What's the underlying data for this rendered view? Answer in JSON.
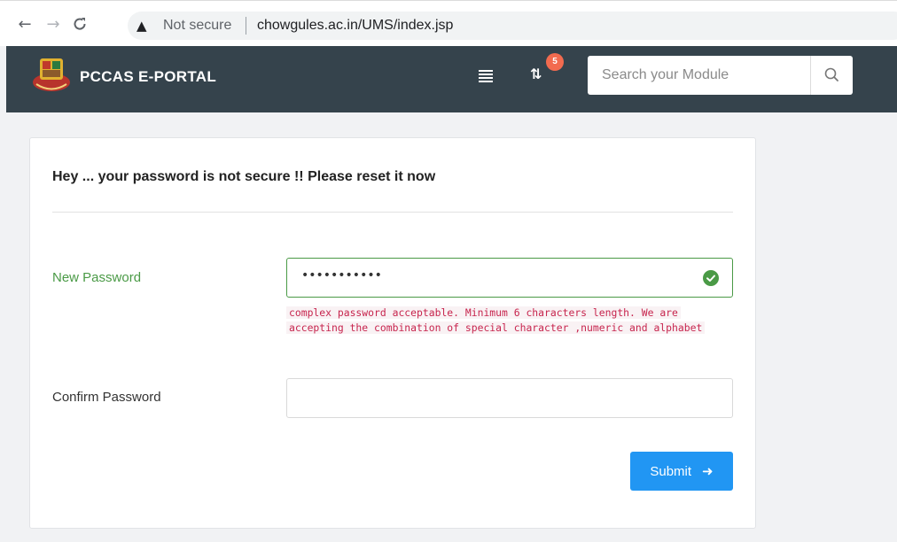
{
  "browser": {
    "back_icon": "←",
    "forward_icon": "→",
    "reload_icon": "C",
    "security_icon": "▲",
    "security_text": "Not secure",
    "url": "chowgules.ac.in/UMS/index.jsp"
  },
  "header": {
    "brand": "PCCAS E-PORTAL",
    "notification_count": "5",
    "sync_icon": "⇅",
    "search_placeholder": "Search your Module",
    "background": "#35434c"
  },
  "form": {
    "title": "Hey ... your password is not secure !! Please reset it now",
    "new_password_label": "New Password",
    "new_password_value": "•••••••••••",
    "hint": "complex password acceptable. Minimum 6 characters length. We are accepting the combination of special character ,numeric and alphabet",
    "confirm_password_label": "Confirm Password",
    "confirm_password_value": "",
    "submit_label": "Submit",
    "submit_arrow": "➜"
  },
  "colors": {
    "accent": "#2196f3",
    "success": "#4a9a46",
    "hint_text": "#c7254e",
    "badge": "#f26b4f"
  }
}
